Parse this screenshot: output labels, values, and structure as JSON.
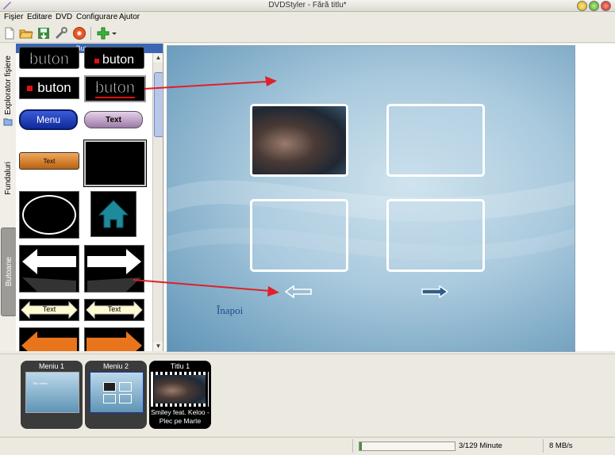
{
  "window": {
    "title": "DVDStyler - Fără titlu*"
  },
  "menubar": [
    "Fişier",
    "Editare",
    "DVD",
    "Configurare",
    "Ajutor"
  ],
  "toolbar": {
    "icons": [
      "new-icon",
      "open-icon",
      "save-icon",
      "settings-wrench-icon",
      "burn-disc-icon",
      "add-icon"
    ]
  },
  "sidebar_tabs": [
    "Explorator fişiere",
    "Fundaluri",
    "Butoane"
  ],
  "palette": {
    "header": "Butoane",
    "buttons": [
      {
        "label": "buton"
      },
      {
        "label": "buton"
      },
      {
        "label": "buton"
      },
      {
        "label": "buton"
      },
      {
        "label": "Menu"
      },
      {
        "label": "Text"
      },
      {
        "label": "Text"
      },
      {
        "label": "Text"
      },
      {
        "label": "Text"
      }
    ]
  },
  "menu_canvas": {
    "back_label": "Înapoi"
  },
  "thumbnails": [
    {
      "label": "Meniu 1",
      "inner": "Titlu meniu"
    },
    {
      "label": "Meniu 2"
    },
    {
      "label": "Titlu 1",
      "caption": "Smiley feat. Keloo - Plec pe Marte"
    }
  ],
  "status": {
    "progress_fraction": 0.0233,
    "duration": "3/129 Minute",
    "rate": "8 MB/s"
  },
  "colors": {
    "palette_header": "#3a66b4",
    "annotation_arrow": "#e0202a"
  }
}
